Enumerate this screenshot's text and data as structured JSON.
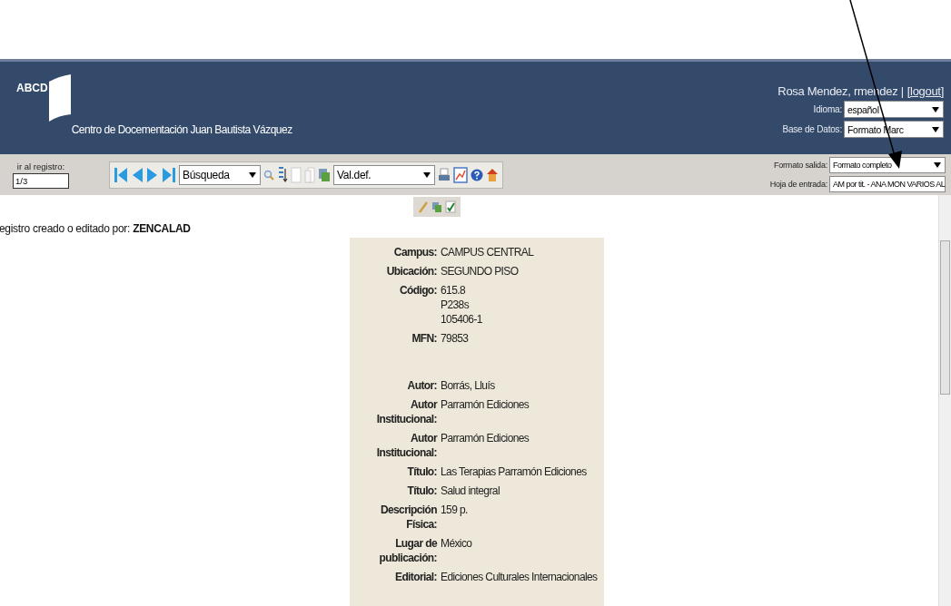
{
  "header": {
    "logo": "ABCD",
    "title": "Centro de Docementación Juan Bautista Vázquez",
    "user": "Rosa Mendez, rmendez |",
    "logout": "[logout]",
    "selects": [
      {
        "label": "Idioma:",
        "value": "español"
      },
      {
        "label": "Base de Datos:",
        "value": "Formato Marc"
      }
    ]
  },
  "toolbar": {
    "goto_label": "ir al registro:",
    "goto_value": "1/3",
    "search_select": "Búsqueda",
    "defaults_select": "Val.def.",
    "right_selects": [
      {
        "label": "Formato salida:",
        "value": "Formato completo"
      },
      {
        "label": "Hoja de entrada:",
        "value": "AM por tit. - ANA MON VARIOS AL"
      }
    ]
  },
  "content": {
    "editor": "ZENCALAD",
    "editor_label_visible": "egistro creado o editado por:",
    "record": {
      "groups": [
        [
          {
            "label": "Campus:",
            "values": [
              "CAMPUS CENTRAL"
            ]
          },
          {
            "label": "Ubicación:",
            "values": [
              "SEGUNDO PISO"
            ]
          },
          {
            "label": "Código:",
            "values": [
              "615.8",
              "P238s",
              "105406-1"
            ]
          },
          {
            "label": "MFN:",
            "values": [
              "79853"
            ]
          }
        ],
        [
          {
            "label": "Autor:",
            "values": [
              "Borrás, Lluís"
            ]
          },
          {
            "label": "Autor Institucional:",
            "values": [
              "Parramón Ediciones"
            ]
          },
          {
            "label": "Autor Institucional:",
            "values": [
              "Parramón Ediciones"
            ]
          },
          {
            "label": "Título:",
            "values": [
              "Las Terapias Parramón Ediciones"
            ]
          },
          {
            "label": "Título:",
            "values": [
              "Salud integral"
            ]
          },
          {
            "label": "Descripción Física:",
            "values": [
              "159 p."
            ]
          },
          {
            "label": "Lugar de publicación:",
            "values": [
              "México"
            ]
          },
          {
            "label": "Editorial:",
            "values": [
              "Ediciones Culturales Internacionales"
            ]
          }
        ]
      ]
    }
  }
}
